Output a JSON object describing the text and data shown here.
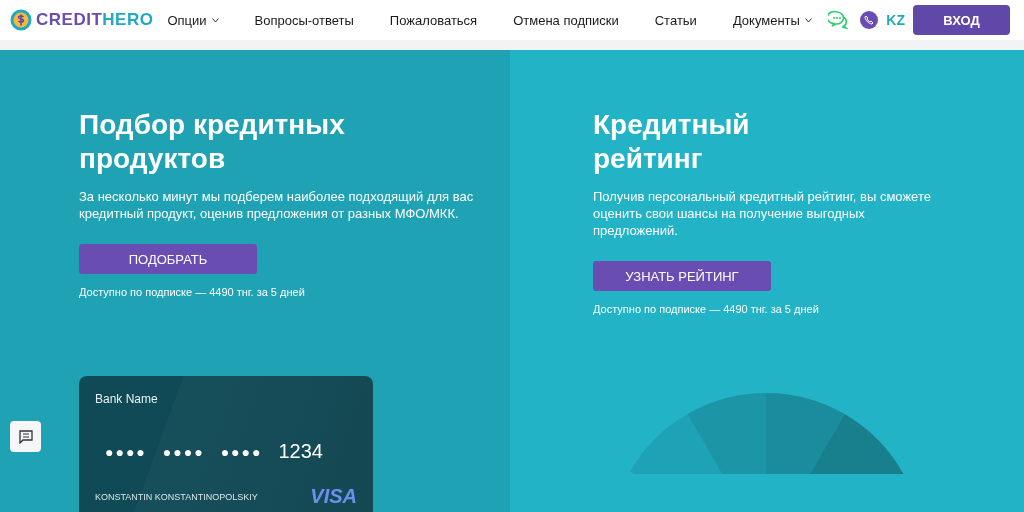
{
  "header": {
    "logo": {
      "part1": "CREDIT",
      "part2": "HERO"
    },
    "nav": [
      {
        "label": "Опции",
        "dropdown": true
      },
      {
        "label": "Вопросы-ответы",
        "dropdown": false
      },
      {
        "label": "Пожаловаться",
        "dropdown": false
      },
      {
        "label": "Отмена подписки",
        "dropdown": false
      },
      {
        "label": "Статьи",
        "dropdown": false
      },
      {
        "label": "Документы",
        "dropdown": true
      }
    ],
    "language": "KZ",
    "login": "ВХОД"
  },
  "panels": [
    {
      "title": "Подбор кредитных продуктов",
      "text": "За несколько минут мы подберем наиболее подходящий для вас кредитный продукт, оценив предложения от разных МФО/МКК.",
      "button": "ПОДОБРАТЬ",
      "note": "Доступно по подписке — 4490 тнг. за 5 дней",
      "kind": "card"
    },
    {
      "title": "Кредитный рейтинг",
      "text": "Получив персональный кредитный рейтинг, вы сможете оценить свои шансы на получение выгодных предложений.",
      "button": "УЗНАТЬ РЕЙТИНГ",
      "note": "Доступно по подписке — 4490 тнг. за 5 дней",
      "kind": "gauge"
    }
  ],
  "card": {
    "bank": "Bank Name",
    "groups": [
      "●●●●",
      "●●●●",
      "●●●●"
    ],
    "last": "1234",
    "holder": "KONSTANTIN KONSTANTINOPOLSKIY",
    "brand": "VISA"
  }
}
